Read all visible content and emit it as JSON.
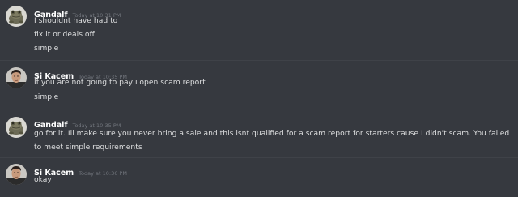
{
  "messages": [
    {
      "username": "Gandalf",
      "timestamp": "Today at 10:31 PM",
      "avatar": "frog-avatar",
      "lines": [
        "I shouldnt have had to",
        "fix it or deals off",
        "simple"
      ]
    },
    {
      "username": "Si Kacem",
      "timestamp": "Today at 10:35 PM",
      "avatar": "man-avatar",
      "lines": [
        "If you are not going to pay i open scam report",
        "simple"
      ]
    },
    {
      "username": "Gandalf",
      "timestamp": "Today at 10:35 PM",
      "avatar": "frog-avatar",
      "lines": [
        "go for it. Ill make sure you never bring a sale and this isnt qualified for a scam report for starters cause I didn't scam. You failed to meet simple requirements"
      ]
    },
    {
      "username": "Si Kacem",
      "timestamp": "Today at 10:36 PM",
      "avatar": "man-avatar",
      "lines": [
        "okay"
      ]
    }
  ]
}
